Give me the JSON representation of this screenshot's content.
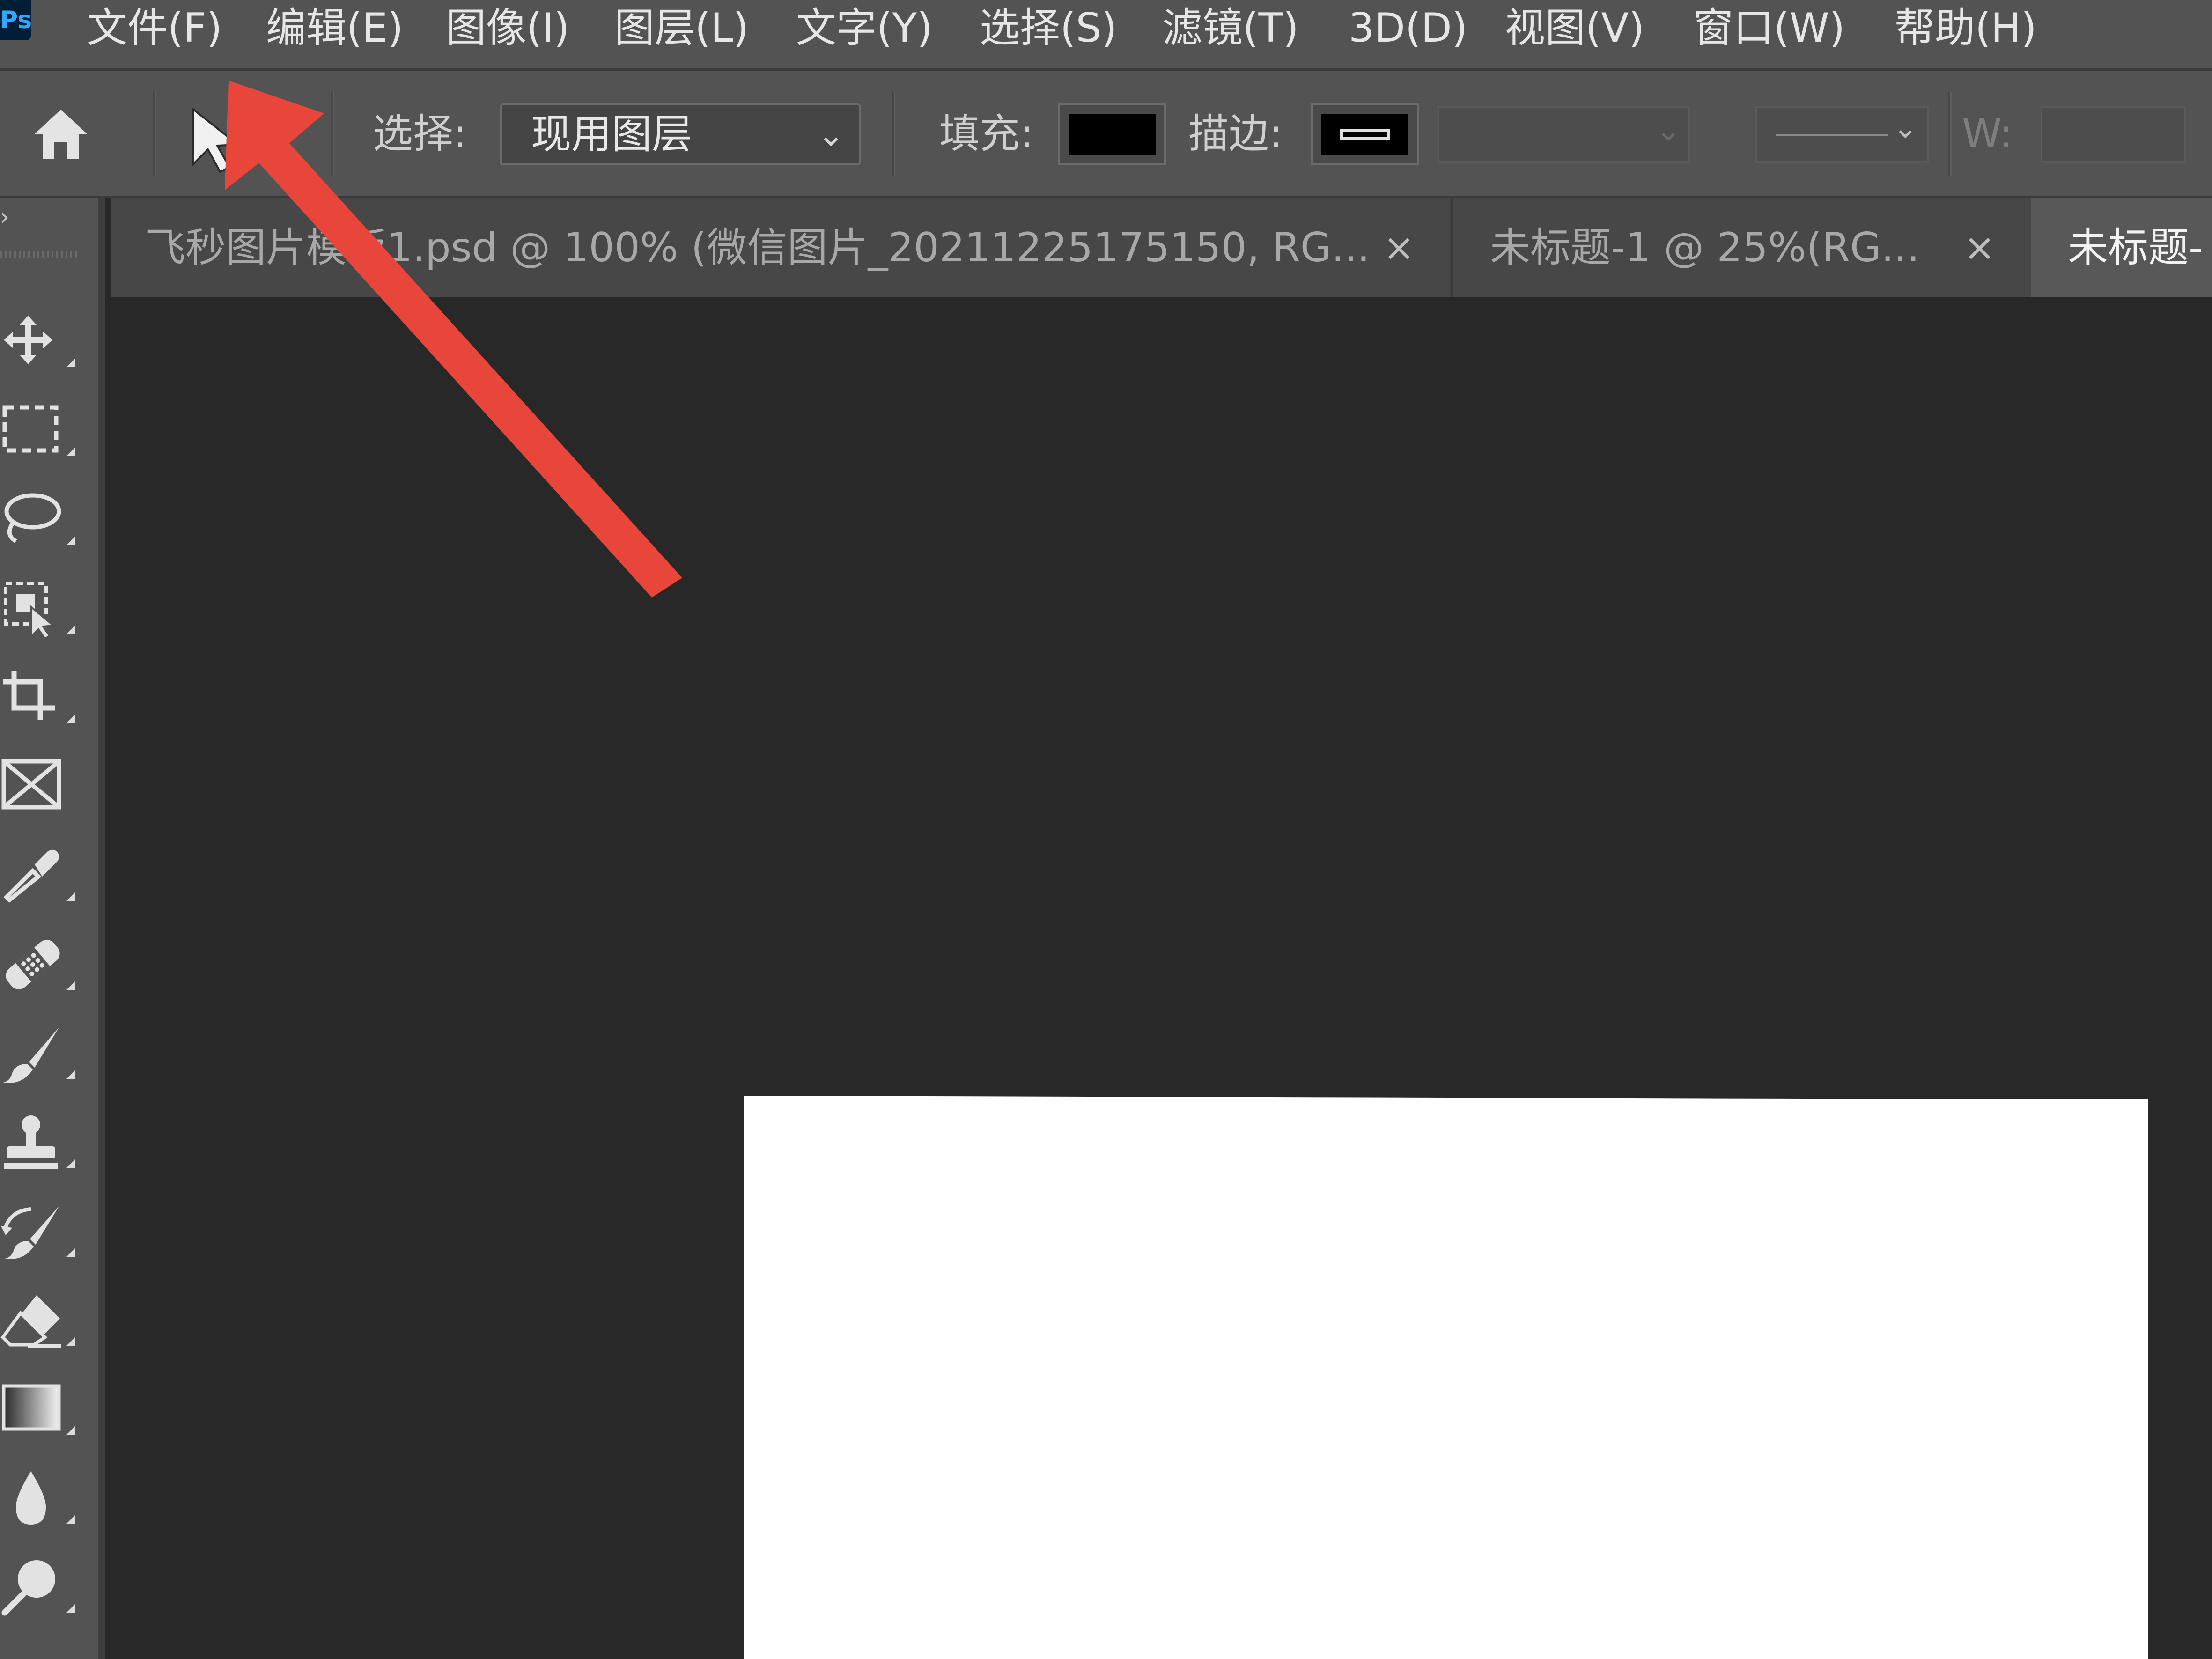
{
  "app": {
    "logo": "Ps"
  },
  "menu": [
    "文件(F)",
    "编辑(E)",
    "图像(I)",
    "图层(L)",
    "文字(Y)",
    "选择(S)",
    "滤镜(T)",
    "3D(D)",
    "视图(V)",
    "窗口(W)",
    "帮助(H)"
  ],
  "options": {
    "home_icon": "home-icon",
    "tool_icon": "path-selection-icon",
    "select_label": "选择:",
    "select_value": "现用图层",
    "fill_label": "填充:",
    "fill_color": "#000000",
    "stroke_label": "描边:",
    "w_label": "W:"
  },
  "tabs": [
    {
      "title": "飞秒图片模板1.psd @ 100% (微信图片_20211225175150, RG...",
      "close": "×",
      "active": false
    },
    {
      "title": "未标题-1 @ 25%(RG...",
      "close": "×",
      "active": false
    },
    {
      "title": "未标题-",
      "active": true
    }
  ],
  "tools": [
    "move-icon",
    "rectangular-marquee-icon",
    "lasso-icon",
    "object-selection-icon",
    "crop-icon",
    "frame-icon",
    "eyedropper-icon",
    "healing-brush-icon",
    "brush-icon",
    "clone-stamp-icon",
    "history-brush-icon",
    "eraser-icon",
    "gradient-icon",
    "blur-icon",
    "dodge-icon"
  ],
  "colors": {
    "annotation_arrow": "#e8463a",
    "canvas": "#ffffff",
    "workspace": "#282828",
    "panel": "#535353"
  }
}
